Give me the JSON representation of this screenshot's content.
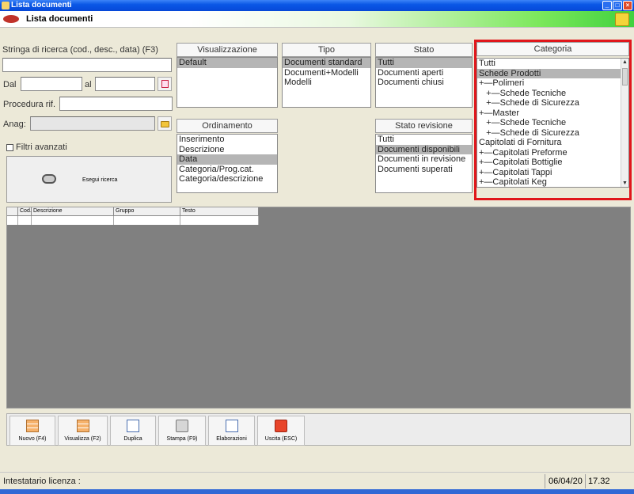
{
  "window": {
    "title": "Lista documenti"
  },
  "header": {
    "title": "Lista documenti"
  },
  "search": {
    "query_label": "Stringa di ricerca (cod., desc., data) (F3)",
    "query_value": "",
    "from_label": "Dal",
    "to_label": "al",
    "procedure_label": "Procedura rif.",
    "anag_label": "Anag:",
    "advanced_label": "Filtri avanzati",
    "search_button": "Esegui ricerca"
  },
  "panels": {
    "visualizzazione": {
      "title": "Visualizzazione",
      "items": [
        "Default"
      ],
      "selected": 0
    },
    "tipo": {
      "title": "Tipo",
      "items": [
        "Documenti standard",
        "Documenti+Modelli",
        "Modelli"
      ],
      "selected": 0
    },
    "stato": {
      "title": "Stato",
      "items": [
        "Tutti",
        "Documenti aperti",
        "Documenti chiusi"
      ],
      "selected": 0
    },
    "categoria": {
      "title": "Categoria",
      "items": [
        "Tutti",
        "Schede Prodotti",
        "+—Polimeri",
        "   +—Schede Tecniche",
        "   +—Schede di Sicurezza",
        "+—Master",
        "   +—Schede Tecniche",
        "   +—Schede di Sicurezza",
        "Capitolati di Fornitura",
        "+—Capitolati Preforme",
        "+—Capitolati Bottiglie",
        "+—Capitolati Tappi",
        "+—Capitolati Keg"
      ],
      "selected": 1
    },
    "ordinamento": {
      "title": "Ordinamento",
      "items": [
        "Inserimento",
        "Descrizione",
        "Data",
        "Categoria/Prog.cat.",
        "Categoria/descrizione"
      ],
      "selected": 2
    },
    "stato_revisione": {
      "title": "Stato revisione",
      "items": [
        "Tutti",
        "Documenti disponibili",
        "Documenti in revisione",
        "Documenti superati"
      ],
      "selected": 1
    }
  },
  "grid": {
    "columns": [
      "",
      "Cod.",
      "Descrizione",
      "Gruppo",
      "Testo"
    ]
  },
  "toolbar": {
    "buttons": [
      {
        "label": "Nuovo (F4)",
        "icon": "new-grid-icon"
      },
      {
        "label": "Visualizza (F2)",
        "icon": "view-grid-icon"
      },
      {
        "label": "Duplica",
        "icon": "duplicate-doc-icon"
      },
      {
        "label": "Stampa (F9)",
        "icon": "printer-icon"
      },
      {
        "label": "Elaborazioni",
        "icon": "processing-doc-icon"
      },
      {
        "label": "Uscita (ESC)",
        "icon": "exit-icon"
      }
    ]
  },
  "status": {
    "license_label": "Intestatario licenza :",
    "date": "06/04/20",
    "time": "17.32"
  }
}
